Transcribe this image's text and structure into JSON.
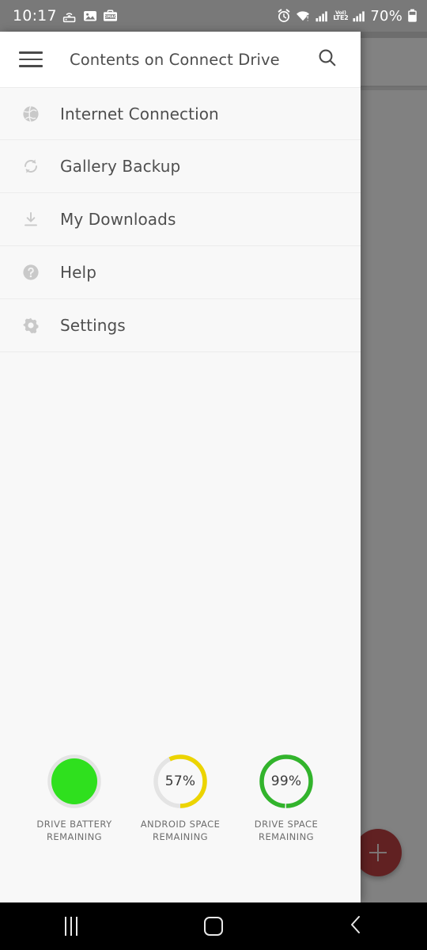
{
  "status_bar": {
    "time": "10:17",
    "battery_percent": "70%",
    "volte_top": "VoI)",
    "volte_bottom": "LTE2",
    "left_icons": [
      "hotspot-icon",
      "gallery-image-icon",
      "gmac-badge-icon"
    ],
    "right_icons": [
      "alarm-icon",
      "wifi-warning-icon",
      "signal-bars-icon",
      "volte-label",
      "signal-bars-2-icon",
      "battery-icon"
    ],
    "badge_text": "GMAC"
  },
  "app_bar": {
    "title": "Contents on Connect Drive",
    "menu_icon": "hamburger-menu-icon",
    "search_icon": "search-icon"
  },
  "drawer": {
    "items": [
      {
        "label": "Internet Connection",
        "icon": "globe-icon"
      },
      {
        "label": "Gallery Backup",
        "icon": "sync-refresh-icon"
      },
      {
        "label": "My Downloads",
        "icon": "download-icon"
      },
      {
        "label": "Help",
        "icon": "help-circle-icon"
      },
      {
        "label": "Settings",
        "icon": "gear-icon"
      }
    ]
  },
  "gauges": [
    {
      "label_line1": "DRIVE BATTERY",
      "label_line2": "REMAINING",
      "value_text": "",
      "percent": 100,
      "style": "filled-disc",
      "color": "#2fe01e",
      "track_color": "#e4e4e4"
    },
    {
      "label_line1": "ANDROID SPACE",
      "label_line2": "REMAINING",
      "value_text": "57%",
      "percent": 57,
      "style": "arc",
      "color": "#ecd400",
      "track_color": "#e4e4e4"
    },
    {
      "label_line1": "DRIVE SPACE",
      "label_line2": "REMAINING",
      "value_text": "99%",
      "percent": 99,
      "style": "arc",
      "color": "#32b42c",
      "track_color": "#e4e4e4"
    }
  ],
  "fab": {
    "icon": "plus-icon",
    "color": "#b0191c"
  },
  "nav_bar": {
    "recents_icon": "recents-icon",
    "home_icon": "home-icon",
    "back_icon": "back-chevron-icon"
  }
}
